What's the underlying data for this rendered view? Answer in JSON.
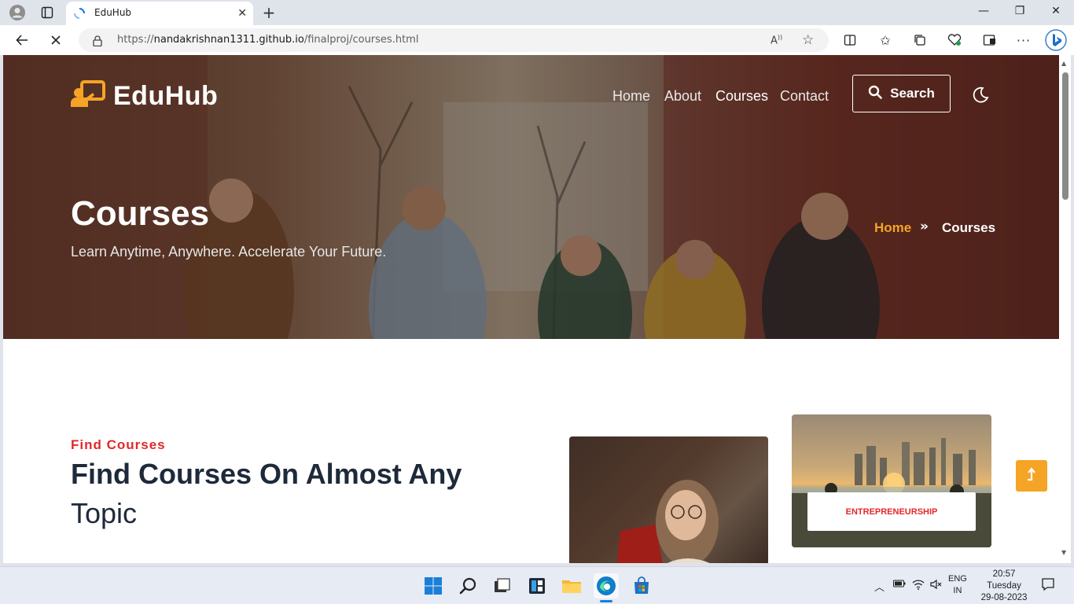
{
  "browser": {
    "tab_title": "EduHub",
    "url_prefix": "https://",
    "url_host": "nandakrishnan1311.github.io",
    "url_path": "/finalproj/courses.html"
  },
  "site": {
    "brand": "EduHub",
    "nav": [
      "Home",
      "About",
      "Courses",
      "Contact"
    ],
    "search_label": "Search",
    "hero_title": "Courses",
    "hero_subtitle": "Learn Anytime, Anywhere. Accelerate Your Future.",
    "breadcrumb_home": "Home",
    "breadcrumb_current": "Courses",
    "kicker": "Find Courses",
    "heading_bold": "Find Courses On Almost Any",
    "heading_light": "Topic",
    "category_label": "ENTREPRENEURSHIP"
  },
  "taskbar": {
    "lang_line1": "ENG",
    "lang_line2": "IN",
    "time": "20:57",
    "day": "Tuesday",
    "date": "29-08-2023"
  },
  "colors": {
    "accent_orange": "#f5a425",
    "accent_red": "#e3272b",
    "heading_navy": "#1e2a3a"
  }
}
